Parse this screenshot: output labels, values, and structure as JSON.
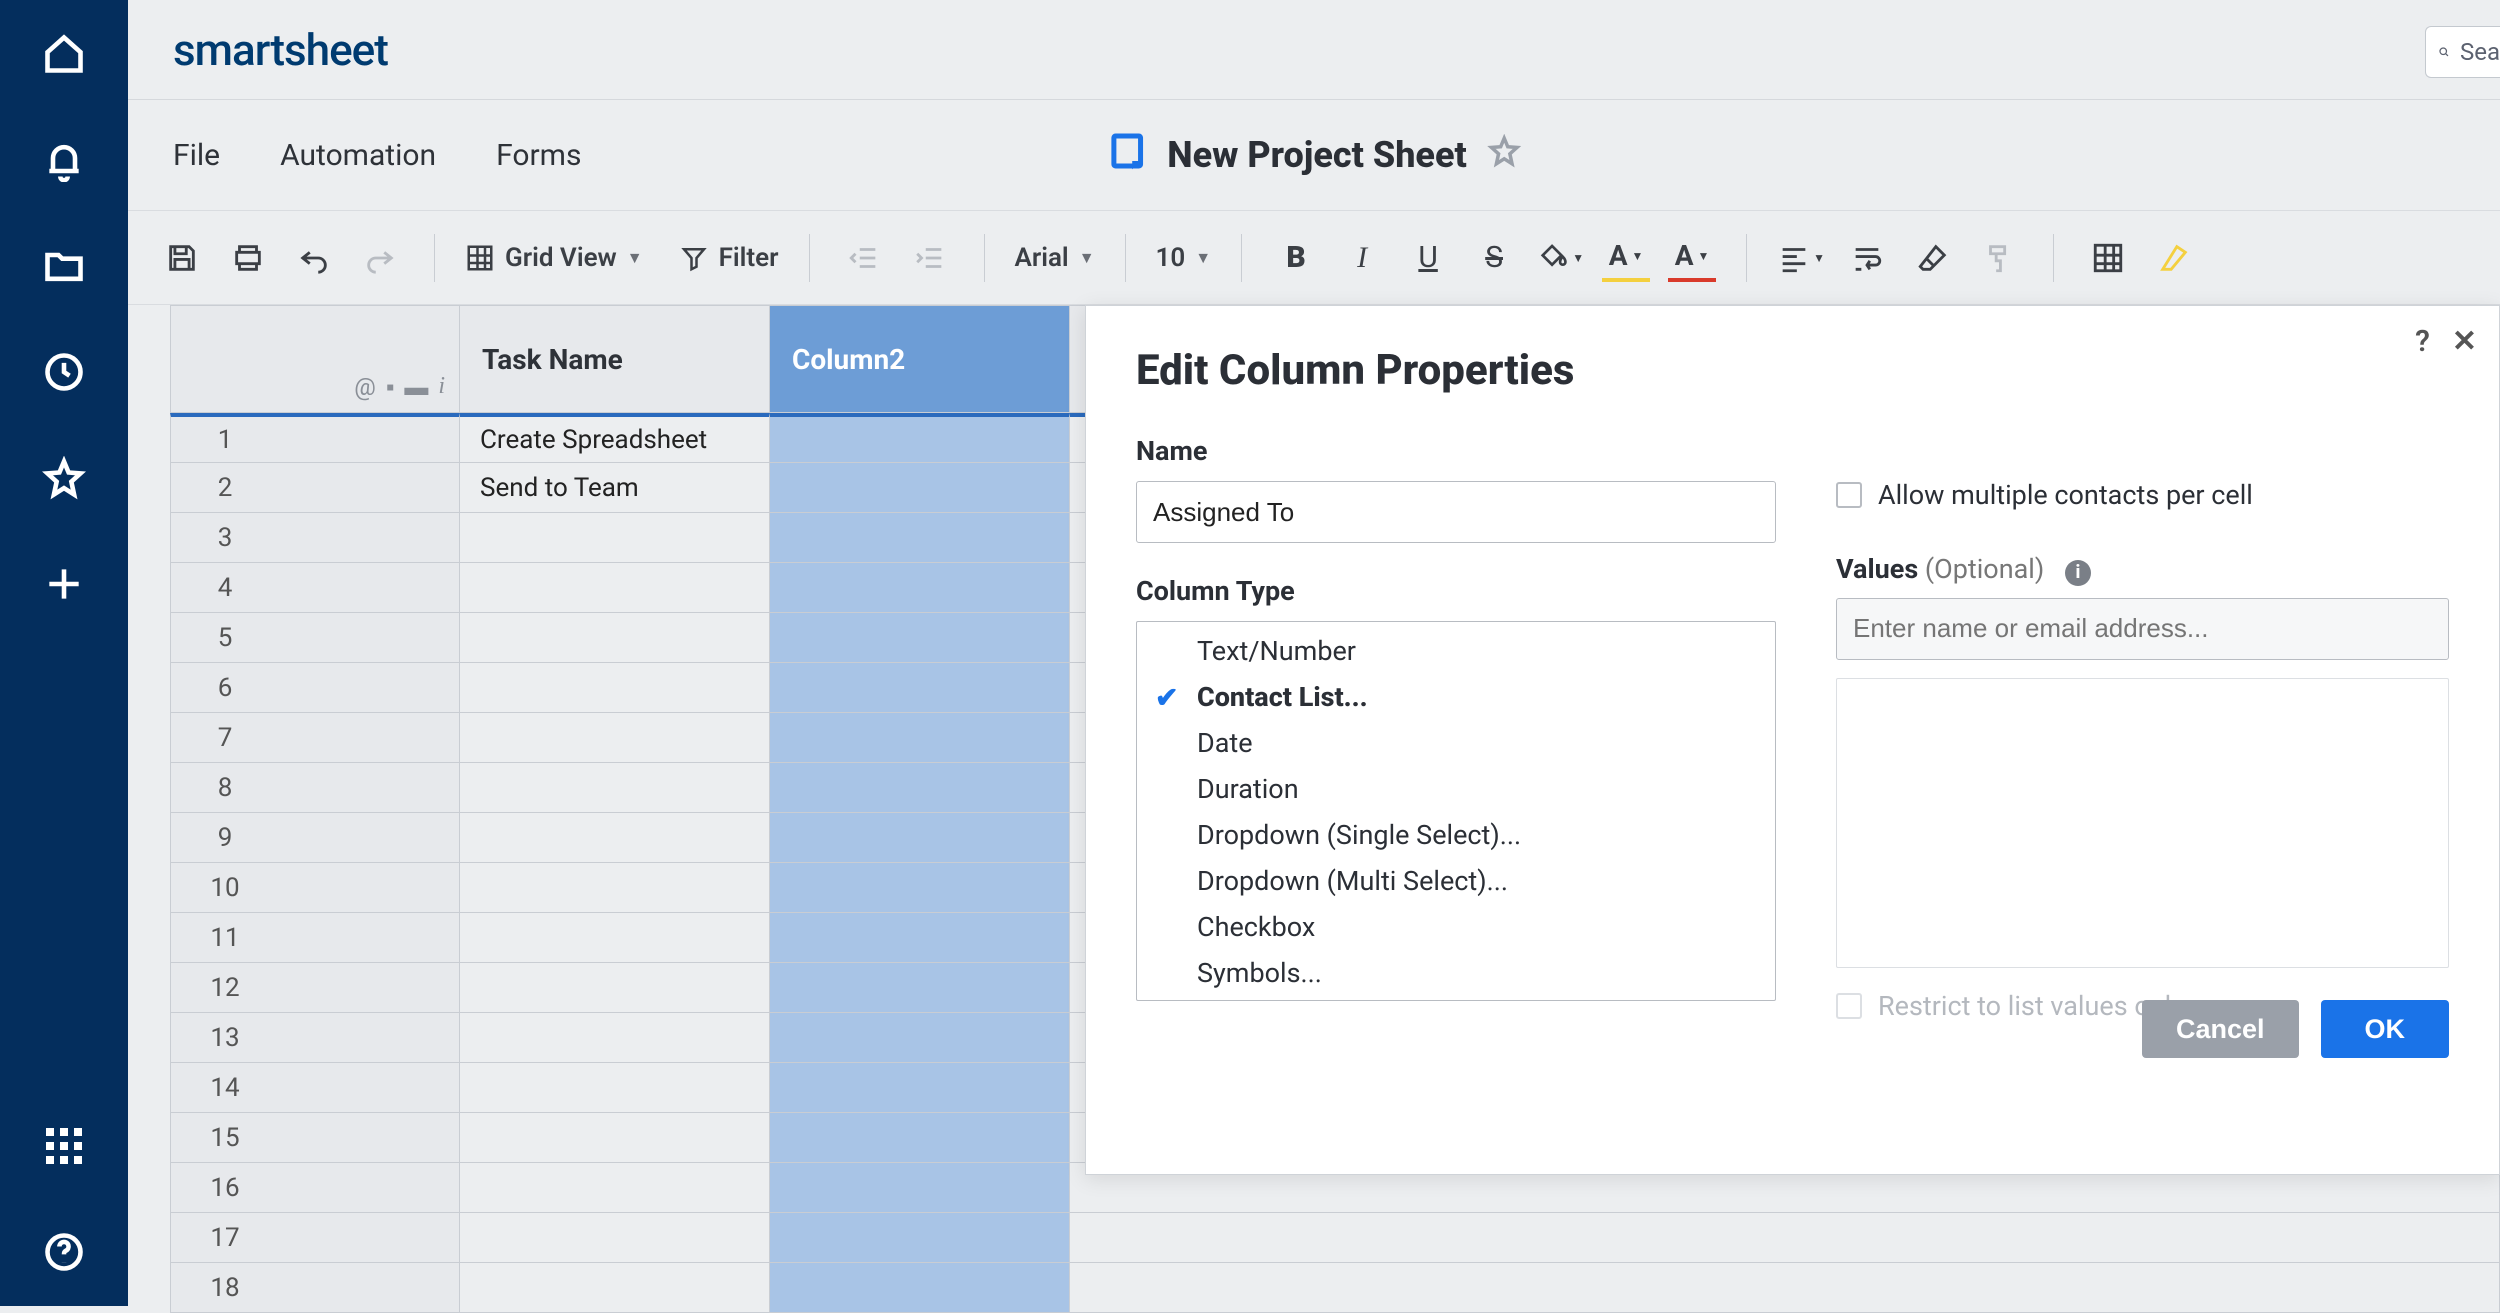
{
  "brand": "smartsheet",
  "search_placeholder": "Sea",
  "menu": {
    "file": "File",
    "automation": "Automation",
    "forms": "Forms"
  },
  "sheet_title": "New Project Sheet",
  "toolbar": {
    "view_label": "Grid View",
    "filter_label": "Filter",
    "font": "Arial",
    "font_size": "10"
  },
  "columns": {
    "task": "Task Name",
    "col2": "Column2"
  },
  "rows": [
    {
      "num": "1",
      "task": "Create Spreadsheet"
    },
    {
      "num": "2",
      "task": "Send to Team"
    },
    {
      "num": "3",
      "task": ""
    },
    {
      "num": "4",
      "task": ""
    },
    {
      "num": "5",
      "task": ""
    },
    {
      "num": "6",
      "task": ""
    },
    {
      "num": "7",
      "task": ""
    },
    {
      "num": "8",
      "task": ""
    },
    {
      "num": "9",
      "task": ""
    },
    {
      "num": "10",
      "task": ""
    },
    {
      "num": "11",
      "task": ""
    },
    {
      "num": "12",
      "task": ""
    },
    {
      "num": "13",
      "task": ""
    },
    {
      "num": "14",
      "task": ""
    },
    {
      "num": "15",
      "task": ""
    },
    {
      "num": "16",
      "task": ""
    },
    {
      "num": "17",
      "task": ""
    },
    {
      "num": "18",
      "task": ""
    }
  ],
  "dialog": {
    "title": "Edit Column Properties",
    "name_label": "Name",
    "name_value": "Assigned To",
    "type_label": "Column Type",
    "types": [
      "Text/Number",
      "Contact List...",
      "Date",
      "Duration",
      "Dropdown (Single Select)...",
      "Dropdown (Multi Select)...",
      "Checkbox",
      "Symbols..."
    ],
    "selected_type_index": 1,
    "allow_multiple": "Allow multiple contacts per cell",
    "values_label": "Values",
    "values_optional": "(Optional)",
    "values_placeholder": "Enter name or email address...",
    "restrict": "Restrict to list values only",
    "cancel": "Cancel",
    "ok": "OK"
  }
}
